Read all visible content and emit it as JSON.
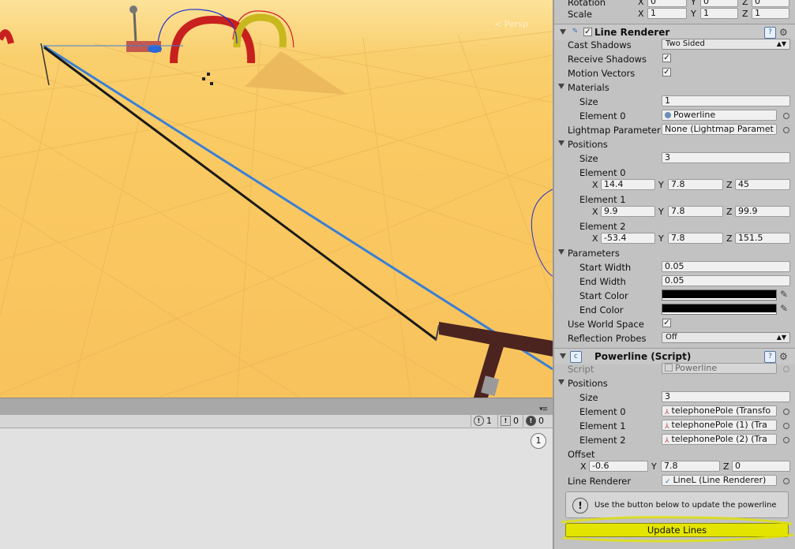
{
  "scene": {
    "view_label": "< Persp"
  },
  "console": {
    "count_info": "1",
    "count_warn": "0",
    "count_err": "0",
    "badge": "1"
  },
  "transform": {
    "rotation_label": "Rotation",
    "rot_x": "0",
    "rot_y": "0",
    "rot_z": "0",
    "scale_label": "Scale",
    "scale_x": "1",
    "scale_y": "1",
    "scale_z": "1"
  },
  "line_renderer": {
    "title": "Line Renderer",
    "cast_shadows_label": "Cast Shadows",
    "cast_shadows_value": "Two Sided",
    "receive_shadows_label": "Receive Shadows",
    "motion_vectors_label": "Motion Vectors",
    "materials_label": "Materials",
    "size_label": "Size",
    "materials_size": "1",
    "element0_label": "Element 0",
    "material0": "Powerline",
    "lightmap_label": "Lightmap Parameter",
    "lightmap_value": "None (Lightmap Paramet",
    "positions_label": "Positions",
    "positions_size": "3",
    "elements": [
      {
        "label": "Element 0",
        "x": "14.4",
        "y": "7.8",
        "z": "45"
      },
      {
        "label": "Element 1",
        "x": "9.9",
        "y": "7.8",
        "z": "99.9"
      },
      {
        "label": "Element 2",
        "x": "-53.4",
        "y": "7.8",
        "z": "151.5"
      }
    ],
    "parameters_label": "Parameters",
    "start_width_label": "Start Width",
    "start_width": "0.05",
    "end_width_label": "End Width",
    "end_width": "0.05",
    "start_color_label": "Start Color",
    "end_color_label": "End Color",
    "world_space_label": "Use World Space",
    "reflection_label": "Reflection Probes",
    "reflection_value": "Off"
  },
  "powerline": {
    "title": "Powerline (Script)",
    "script_label": "Script",
    "script_value": "Powerline",
    "positions_label": "Positions",
    "size_label": "Size",
    "size_value": "3",
    "elements": [
      {
        "label": "Element 0",
        "value": "telephonePole (Transfo"
      },
      {
        "label": "Element 1",
        "value": "telephonePole (1) (Tra"
      },
      {
        "label": "Element 2",
        "value": "telephonePole (2) (Tra"
      }
    ],
    "offset_label": "Offset",
    "offset_x": "-0.6",
    "offset_y": "7.8",
    "offset_z": "0",
    "line_renderer_label": "Line Renderer",
    "line_renderer_value": "LineL (Line Renderer)",
    "help_text": "Use the button below to update the powerline",
    "button_label": "Update Lines"
  },
  "axis": {
    "x": "X",
    "y": "Y",
    "z": "Z"
  },
  "colors": {
    "highlight": "#e4e401",
    "scene_sand": "#f9c862",
    "wire_blue": "#3a7fd5"
  }
}
